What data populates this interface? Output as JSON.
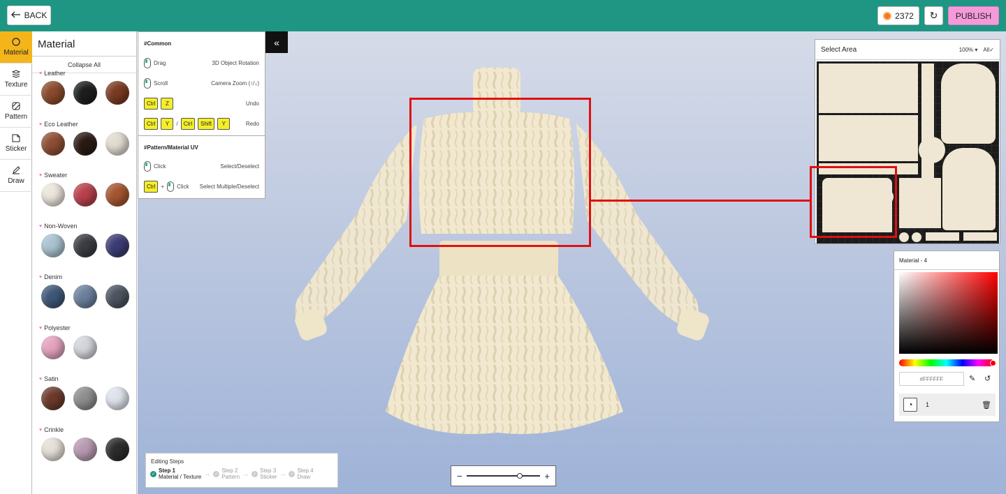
{
  "header": {
    "back_label": "BACK",
    "coins": "2372",
    "publish_label": "PUBLISH"
  },
  "rail": [
    {
      "label": "Material",
      "icon": "material-icon",
      "active": true
    },
    {
      "label": "Texture",
      "icon": "texture-icon",
      "active": false
    },
    {
      "label": "Pattern",
      "icon": "pattern-icon",
      "active": false
    },
    {
      "label": "Sticker",
      "icon": "sticker-icon",
      "active": false
    },
    {
      "label": "Draw",
      "icon": "draw-icon",
      "active": false
    }
  ],
  "material_panel": {
    "title": "Material",
    "collapse_all": "Collapse All",
    "categories": [
      {
        "name": "Leather",
        "swatches": [
          "#8a4a2c",
          "#1e1e1e",
          "#7a3a20"
        ]
      },
      {
        "name": "Eco Leather",
        "swatches": [
          "#8e4e33",
          "#2a1a14",
          "#e2dcd2"
        ]
      },
      {
        "name": "Sweater",
        "swatches": [
          "#ece6dc",
          "#b8404c",
          "#a55530"
        ]
      },
      {
        "name": "Non-Woven",
        "swatches": [
          "#a9c3d0",
          "#3a3d44",
          "#3b3c74"
        ]
      },
      {
        "name": "Denim",
        "swatches": [
          "#3e5877",
          "#6c809d",
          "#4c5460"
        ]
      },
      {
        "name": "Polyester",
        "swatches": [
          "#e4a3bf",
          "#d4d6dc"
        ]
      },
      {
        "name": "Satin",
        "swatches": [
          "#6c3a2c",
          "#8e8e8e",
          "#dfe3ec"
        ]
      },
      {
        "name": "Crinkle",
        "swatches": [
          "#e6e0d8",
          "#b89ab0",
          "#2b2d2b"
        ]
      }
    ]
  },
  "shortcuts": {
    "common_title": "#Common",
    "drag": "Drag",
    "drag_action": "3D Object Rotation",
    "scroll": "Scroll",
    "scroll_action": "Camera Zoom (↑/↓)",
    "undo_keys": [
      "Ctrl",
      "Z"
    ],
    "undo_action": "Undo",
    "redo_keys_a": [
      "Ctrl",
      "Y"
    ],
    "redo_sep": "/",
    "redo_keys_b": [
      "Ctrl",
      "Shift",
      "Y"
    ],
    "redo_action": "Redo",
    "uv_title": "#Pattern/Material UV",
    "click": "Click",
    "click_action": "Select/Deselect",
    "plus": "+",
    "multi_key": "Ctrl",
    "multi_click": "Click",
    "multi_action": "Select Multiple/Deselect",
    "collapse_icon": "«"
  },
  "select_area": {
    "title": "Select Area",
    "zoom": "100%",
    "filter": "All"
  },
  "color_panel": {
    "title": "Material - 4",
    "hex": "#FFFFFF",
    "layer_index": "1",
    "hue_color": "#ff0000"
  },
  "steps": {
    "title": "Editing Steps",
    "items": [
      {
        "name": "Step 1",
        "desc": "Material / Texture",
        "active": true
      },
      {
        "name": "Step 2",
        "desc": "Pattern",
        "active": false
      },
      {
        "name": "Step 3",
        "desc": "Sticker",
        "active": false
      },
      {
        "name": "Step 4",
        "desc": "Draw",
        "active": false
      }
    ]
  },
  "zoom_control": {
    "minus": "−",
    "plus": "+",
    "level": 0.68
  }
}
